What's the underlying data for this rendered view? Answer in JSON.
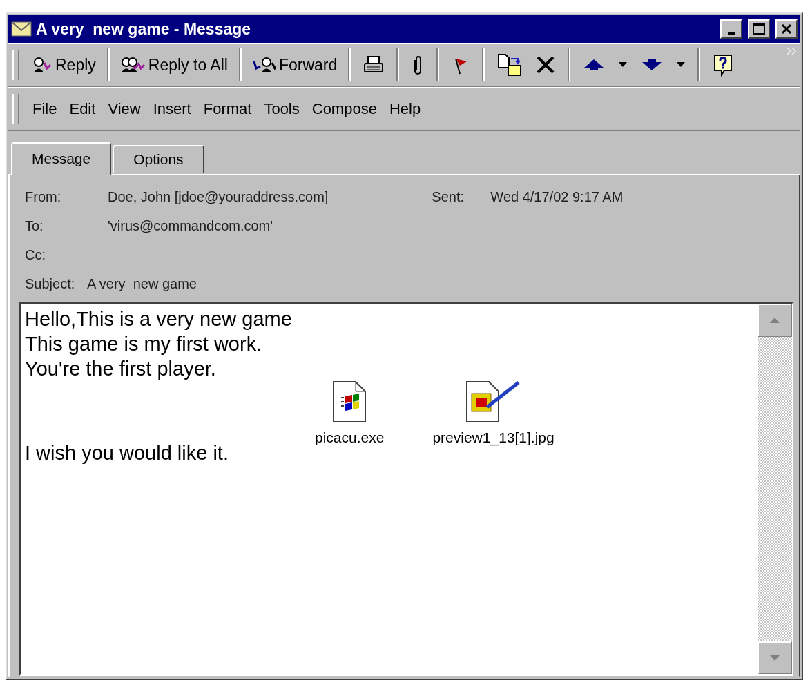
{
  "window": {
    "title": "A very  new game - Message"
  },
  "toolbar": {
    "buttons": [
      {
        "label": "Reply"
      },
      {
        "label": "Reply to All"
      },
      {
        "label": "Forward"
      }
    ]
  },
  "menu": [
    "File",
    "Edit",
    "View",
    "Insert",
    "Format",
    "Tools",
    "Compose",
    "Help"
  ],
  "tabs": [
    {
      "label": "Message",
      "selected": true
    },
    {
      "label": "Options",
      "selected": false
    }
  ],
  "header": {
    "from": {
      "label": "From:",
      "value": "Doe, John [jdoe@youraddress.com]"
    },
    "sent": {
      "label": "Sent:",
      "value": "Wed 4/17/02 9:17 AM"
    },
    "to": {
      "label": "To:",
      "value": "'virus@commandcom.com'"
    },
    "cc": {
      "label": "Cc:"
    },
    "subject": {
      "label": "Subject:",
      "value": "A very  new game"
    }
  },
  "body": {
    "lines": [
      "Hello,This is a very new game",
      "This game is my first work.",
      "You're the first player."
    ],
    "closing": "I wish you would like it.",
    "attachments": [
      {
        "kind": "exe",
        "name": "picacu.exe"
      },
      {
        "kind": "image",
        "name": "preview1_13[1].jpg"
      }
    ]
  }
}
